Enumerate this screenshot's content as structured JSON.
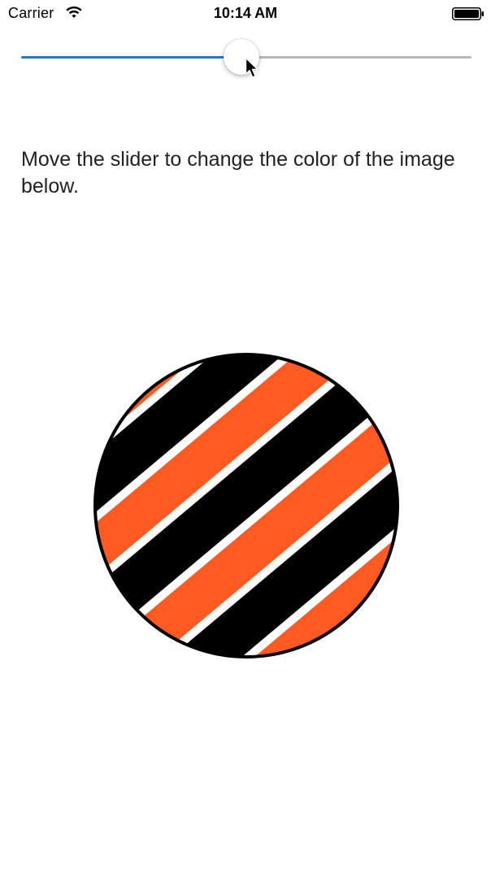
{
  "status_bar": {
    "carrier": "Carrier",
    "time": "10:14 AM",
    "wifi_icon": "wifi-icon",
    "battery_icon": "battery-full-icon"
  },
  "slider": {
    "value": 0.49,
    "track_color": "#b7b7b7",
    "fill_color": "#1a7ae0"
  },
  "instruction_text": "Move the slider to change the color of the image below.",
  "image": {
    "icon": "striped-circle-image",
    "stripe_colors": [
      "#ff5a22",
      "#000000",
      "#ffffff"
    ]
  },
  "cursor_icon": "mouse-pointer-icon"
}
